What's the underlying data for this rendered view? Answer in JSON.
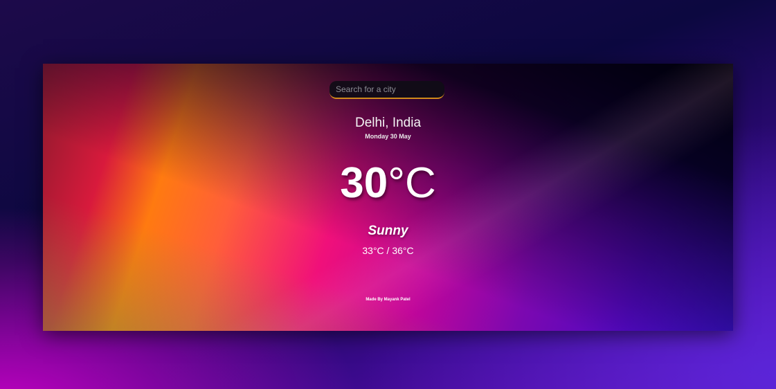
{
  "search": {
    "placeholder": "Search for a city",
    "value": ""
  },
  "location": {
    "city": "Delhi, India",
    "date": "Monday 30 May"
  },
  "current": {
    "temperature": "30",
    "unit": "°C",
    "condition": "Sunny",
    "range": "33°C / 36°C"
  },
  "footer": {
    "credit": "Made By Mayank Patel"
  },
  "colors": {
    "search_underline": "#d08a1a",
    "text": "#ffffff"
  }
}
